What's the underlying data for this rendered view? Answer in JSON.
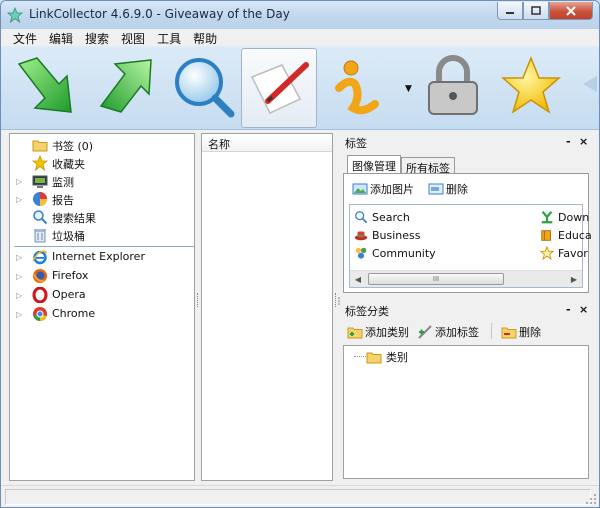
{
  "window": {
    "title": "LinkCollector 4.6.9.0 - Giveaway of the Day"
  },
  "menu": [
    "文件",
    "编辑",
    "搜索",
    "视图",
    "工具",
    "帮助"
  ],
  "toolbar": [
    "down-arrow-icon",
    "up-arrow-icon",
    "search-icon",
    "edit-icon",
    "info-icon",
    "lock-icon",
    "star-icon"
  ],
  "tree": {
    "bookmarks": "书签 (0)",
    "favorites": "收藏夹",
    "monitor": "监测",
    "reports": "报告",
    "search_results": "搜索结果",
    "trash": "垃圾桶",
    "browsers": [
      "Internet Explorer",
      "Firefox",
      "Opera",
      "Chrome"
    ]
  },
  "list": {
    "column_name": "名称"
  },
  "tags": {
    "title": "标签",
    "tab_image_manage": "图像管理",
    "tab_all_tags": "所有标签",
    "add_image": "添加图片",
    "delete": "删除",
    "items_left": [
      "Search",
      "Business",
      "Community"
    ],
    "items_right": [
      "Down",
      "Educa",
      "Favor"
    ],
    "scroll_thumb": "III"
  },
  "categories": {
    "title": "标签分类",
    "add_category": "添加类别",
    "add_tag": "添加标签",
    "delete": "删除",
    "root": "类别"
  },
  "pane_controls": {
    "minimize": "-",
    "close": "×"
  },
  "colors": {
    "accent": "#3a7fc8",
    "title_bar": "#c2d8ee",
    "close_button": "#c9533c"
  }
}
